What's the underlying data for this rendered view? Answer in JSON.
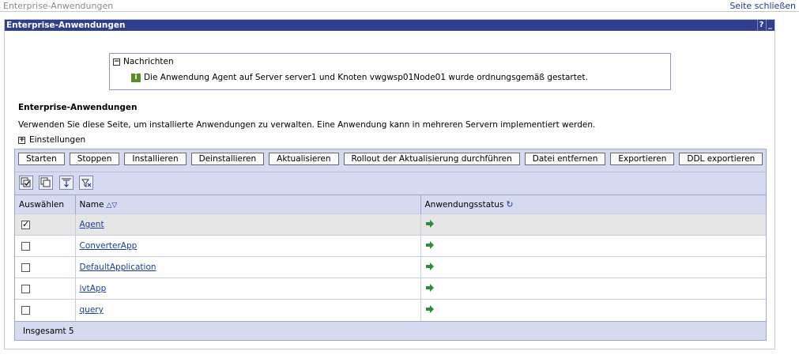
{
  "page": {
    "title": "Enterprise-Anwendungen",
    "close_link": "Seite schließen"
  },
  "portlet": {
    "title": "Enterprise-Anwendungen",
    "help": "?",
    "minimize": "_"
  },
  "messages": {
    "header": "Nachrichten",
    "toggle": "−",
    "text": "Die Anwendung Agent auf Server server1 und Knoten vwgwsp01Node01 wurde ordnungsgemäß gestartet."
  },
  "section": {
    "title": "Enterprise-Anwendungen",
    "description": "Verwenden Sie diese Seite, um installierte Anwendungen zu verwalten. Eine Anwendung kann in mehreren Servern implementiert werden.",
    "settings_label": "Einstellungen",
    "settings_toggle": "+"
  },
  "buttons": [
    "Starten",
    "Stoppen",
    "Installieren",
    "Deinstallieren",
    "Aktualisieren",
    "Rollout der Aktualisierung durchführen",
    "Datei entfernen",
    "Exportieren",
    "DDL exportieren"
  ],
  "table": {
    "headers": {
      "select": "Auswählen",
      "name": "Name",
      "status": "Anwendungsstatus"
    },
    "rows": [
      {
        "name": "Agent",
        "checked": true,
        "status_icon": "started-arrow-icon"
      },
      {
        "name": "ConverterApp",
        "checked": false,
        "status_icon": "started-arrow-icon"
      },
      {
        "name": "DefaultApplication",
        "checked": false,
        "status_icon": "started-arrow-icon"
      },
      {
        "name": "ivtApp",
        "checked": false,
        "status_icon": "started-arrow-icon"
      },
      {
        "name": "query",
        "checked": false,
        "status_icon": "started-arrow-icon"
      }
    ],
    "total": "Insgesamt 5"
  },
  "toolbar_icons": [
    "select-all-icon",
    "deselect-all-icon",
    "show-filter-icon",
    "clear-filter-icon"
  ],
  "colors": {
    "title_bar": "#2f3f8e",
    "panel": "#d5daf0",
    "link": "#1a3c9c",
    "status_green": "#2e8b3a"
  }
}
